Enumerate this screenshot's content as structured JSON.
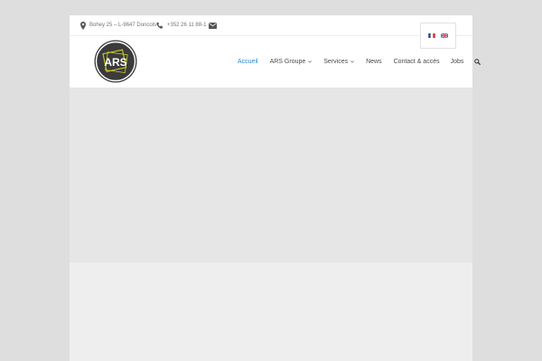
{
  "topbar": {
    "address": "Bohey 25 – L-9647 Doncols",
    "phone": "+352 26 11 88-1",
    "icons": [
      "map-marker-icon",
      "phone-icon",
      "envelope-icon"
    ]
  },
  "logo": {
    "text": "ARS",
    "colors": {
      "circle": "#3b3b3b",
      "ring": "#ffffff",
      "accent": "#c9cc2a"
    }
  },
  "languages": [
    {
      "code": "fr",
      "icon": "flag-france-icon"
    },
    {
      "code": "en",
      "icon": "flag-uk-icon"
    }
  ],
  "nav": {
    "items": [
      {
        "label": "Accueil",
        "active": true,
        "dropdown": false
      },
      {
        "label": "ARS Groupe",
        "active": false,
        "dropdown": true
      },
      {
        "label": "Services",
        "active": false,
        "dropdown": true
      },
      {
        "label": "News",
        "active": false,
        "dropdown": false
      },
      {
        "label": "Contact & accès",
        "active": false,
        "dropdown": false
      },
      {
        "label": "Jobs",
        "active": false,
        "dropdown": false
      }
    ],
    "search_icon": "search-icon"
  },
  "colors": {
    "accent": "#2b89c8",
    "text": "#4b4b4b",
    "page_bg": "#dedede",
    "hero_bg": "#e6e6e6"
  }
}
